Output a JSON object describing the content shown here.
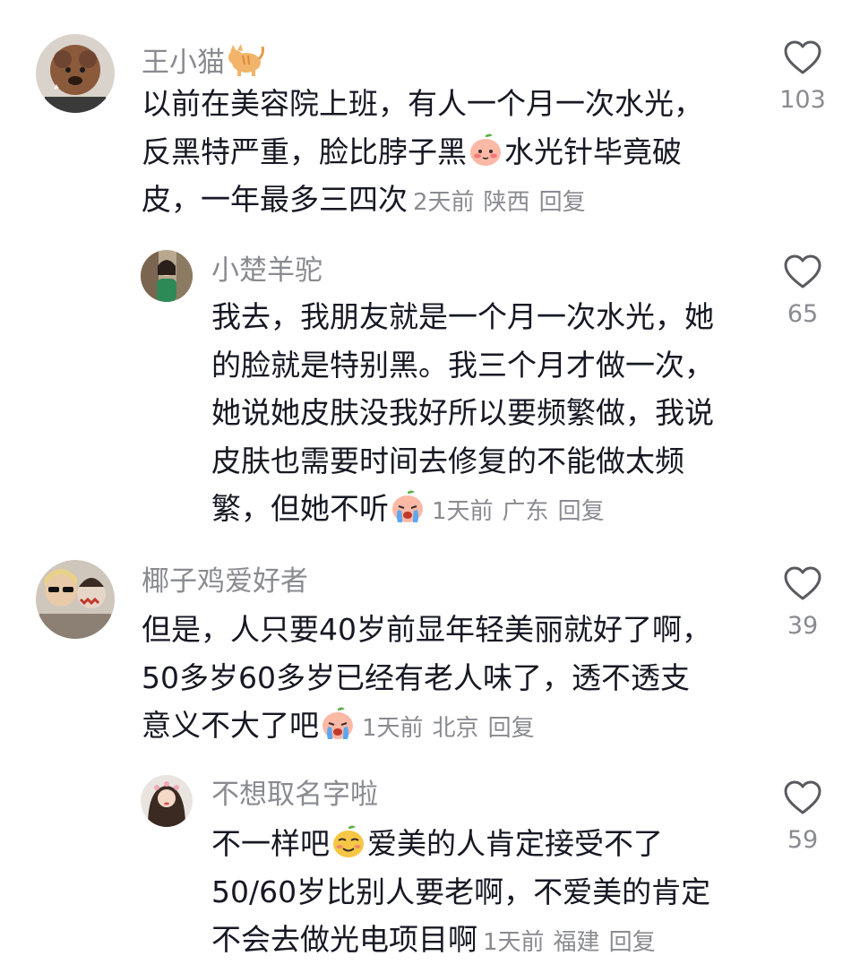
{
  "comments": [
    {
      "username": "王小猫",
      "lines": [
        "以前在美容院上班，有人一个月一次水光，",
        "反黑特严重，脸比脖子黑",
        "水光针毕竟破",
        "皮，一年最多三四次"
      ],
      "time": "2天前",
      "location": "陕西",
      "reply": "回复",
      "likes": "103"
    },
    {
      "username": "小楚羊驼",
      "lines": [
        "我去，我朋友就是一个月一次水光，她",
        "的脸就是特别黑。我三个月才做一次，",
        "她说她皮肤没我好所以要频繁做，我说",
        "皮肤也需要时间去修复的不能做太频",
        "繁，但她不听"
      ],
      "time": "1天前",
      "location": "广东",
      "reply": "回复",
      "likes": "65"
    },
    {
      "username": "椰子鸡爱好者",
      "lines": [
        "但是，人只要40岁前显年轻美丽就好了啊，",
        "50多岁60多岁已经有老人味了，透不透支",
        "意义不大了吧"
      ],
      "time": "1天前",
      "location": "北京",
      "reply": "回复",
      "likes": "39"
    },
    {
      "username": "不想取名字啦",
      "lines": [
        "不一样吧",
        "爱美的人肯定接受不了",
        "50/60岁比别人要老啊，不爱美的肯定",
        "不会去做光电项目啊"
      ],
      "time": "1天前",
      "location": "福建",
      "reply": "回复",
      "likes": "59"
    }
  ],
  "icons": {
    "like": "heart-outline-icon",
    "emoji_peach_blush": "peach-blush-emoji-icon",
    "emoji_peach_cry": "peach-crying-emoji-icon",
    "emoji_peach_smirk": "peach-smirk-emoji-icon",
    "username_emoji": "cat-emoji-icon"
  },
  "colors": {
    "text": "#161823",
    "secondary": "#8a8b91",
    "background": "#ffffff"
  }
}
